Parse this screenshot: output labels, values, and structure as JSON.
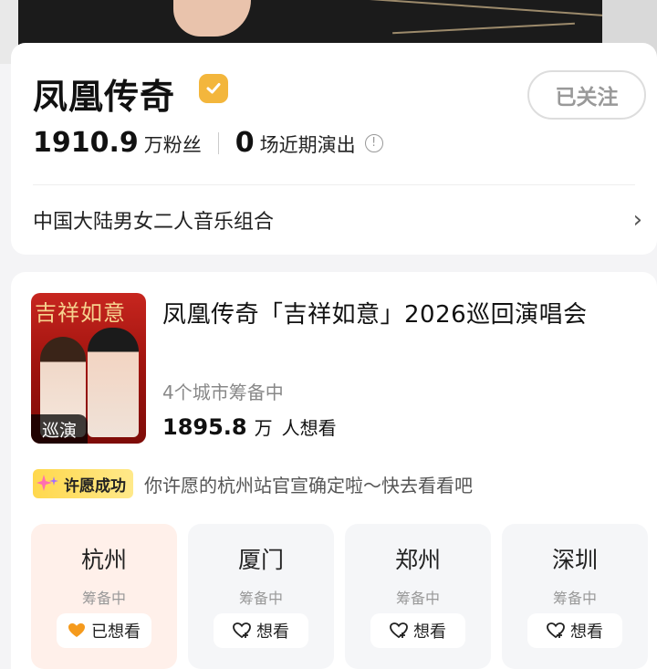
{
  "profile": {
    "name": "凤凰传奇",
    "follow_label": "已关注",
    "fans_count": "1910.9",
    "fans_unit": "万粉丝",
    "shows_count": "0",
    "shows_unit": "场近期演出",
    "info_symbol": "!",
    "description": "中国大陆男女二人音乐组合",
    "verified_icon": "verified-check-icon"
  },
  "tour": {
    "poster_script": "吉祥如意",
    "poster_tag": "巡演",
    "title": "凤凰传奇「吉祥如意」2026巡回演唱会",
    "status": "4个城市筹备中",
    "want_count": "1895.8",
    "want_unit": "万",
    "want_label": "人想看",
    "wish_badge": "许愿成功",
    "wish_text": "你许愿的杭州站官宣确定啦～快去看看吧",
    "cities": [
      {
        "name": "杭州",
        "status": "筹备中",
        "button": "已想看",
        "active": true
      },
      {
        "name": "厦门",
        "status": "筹备中",
        "button": "想看",
        "active": false
      },
      {
        "name": "郑州",
        "status": "筹备中",
        "button": "想看",
        "active": false
      },
      {
        "name": "深圳",
        "status": "筹备中",
        "button": "想看",
        "active": false
      }
    ]
  },
  "colors": {
    "verify": "#f3b63c",
    "wish_badge": "#ffd84d",
    "active_city_bg": "#fff0ea",
    "heart_filled": "#f59a1c"
  }
}
